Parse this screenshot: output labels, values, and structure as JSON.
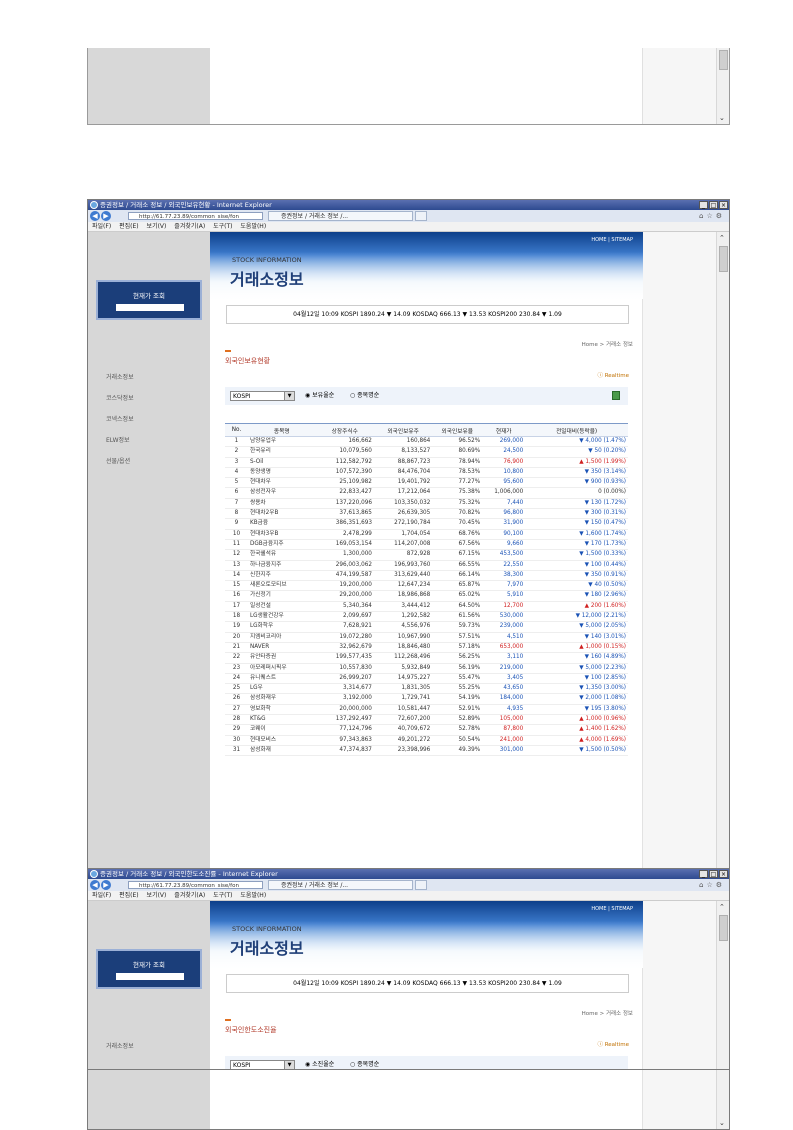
{
  "window": {
    "title1": "증권정보 / 거래소 정보 / 외국인보유현황 - Internet Explorer",
    "title2": "증권정보 / 거래소 정보 / 외국인한도소진률 - Internet Explorer",
    "url": "http://61.77.23.89/common_sise/fon",
    "tab_label": "증권정보 / 거래소 정보 /...",
    "menu": [
      "파일(F)",
      "편집(E)",
      "보기(V)",
      "즐겨찾기(A)",
      "도구(T)",
      "도움말(H)"
    ]
  },
  "banner": {
    "subtitle": "STOCK INFORMATION",
    "title": "거래소정보",
    "links": "HOME  |  SITEMAP"
  },
  "sidebar": {
    "current_price_label": "현재가 조회",
    "items": [
      "거래소정보",
      "코스닥정보",
      "코넥스정보",
      "ELW정보",
      "선물/옵션"
    ]
  },
  "ticker": "04월12일  10:09  KOSPI  1890.24  ▼ 14.09  KOSDAQ  666.13  ▼ 13.53  KOSPI200  230.84  ▼ 1.09",
  "breadcrumb": "Home > 거래소 정보",
  "realtime": "Realtime",
  "page1": {
    "section_title": "외국인보유현황",
    "market": "KOSPI",
    "radio1": "보유율순",
    "radio2": "종목명순"
  },
  "page2": {
    "section_title": "외국인한도소진율",
    "market": "KOSPI",
    "radio1": "소진율순",
    "radio2": "종목명순"
  },
  "table": {
    "headers": [
      "No.",
      "종목명",
      "상장주식수",
      "외국인보유주",
      "외국인보유율",
      "현재가",
      "전일대비(등락율)"
    ],
    "rows": [
      [
        "1",
        "남양유업우",
        "166,662",
        "160,864",
        "96.52%",
        "269,000",
        "▼ 4,000 (1.47%)"
      ],
      [
        "2",
        "한국유리",
        "10,079,560",
        "8,133,527",
        "80.69%",
        "24,500",
        "▼ 50 (0.20%)"
      ],
      [
        "3",
        "S-Oil",
        "112,582,792",
        "88,867,723",
        "78.94%",
        "76,900",
        "▲ 1,500 (1.99%)"
      ],
      [
        "4",
        "동양생명",
        "107,572,390",
        "84,476,704",
        "78.53%",
        "10,800",
        "▼ 350 (3.14%)"
      ],
      [
        "5",
        "현대차우",
        "25,109,982",
        "19,401,792",
        "77.27%",
        "95,600",
        "▼ 900 (0.93%)"
      ],
      [
        "6",
        "삼성전자우",
        "22,833,427",
        "17,212,064",
        "75.38%",
        "1,006,000",
        "0 (0.00%)"
      ],
      [
        "7",
        "쌍용차",
        "137,220,096",
        "103,350,032",
        "75.32%",
        "7,440",
        "▼ 130 (1.72%)"
      ],
      [
        "8",
        "현대차2우B",
        "37,613,865",
        "26,639,305",
        "70.82%",
        "96,800",
        "▼ 300 (0.31%)"
      ],
      [
        "9",
        "KB금융",
        "386,351,693",
        "272,190,784",
        "70.45%",
        "31,900",
        "▼ 150 (0.47%)"
      ],
      [
        "10",
        "현대차3우B",
        "2,478,299",
        "1,704,054",
        "68.76%",
        "90,100",
        "▼ 1,600 (1.74%)"
      ],
      [
        "11",
        "DGB금융지주",
        "169,053,154",
        "114,207,008",
        "67.56%",
        "9,660",
        "▼ 170 (1.73%)"
      ],
      [
        "12",
        "한국쉘석유",
        "1,300,000",
        "872,928",
        "67.15%",
        "453,500",
        "▼ 1,500 (0.33%)"
      ],
      [
        "13",
        "하나금융지주",
        "296,003,062",
        "196,993,760",
        "66.55%",
        "22,550",
        "▼ 100 (0.44%)"
      ],
      [
        "14",
        "신한지주",
        "474,199,587",
        "313,629,440",
        "66.14%",
        "38,300",
        "▼ 350 (0.91%)"
      ],
      [
        "15",
        "새론오토모티브",
        "19,200,000",
        "12,647,234",
        "65.87%",
        "7,970",
        "▼ 40 (0.50%)"
      ],
      [
        "16",
        "가신정기",
        "29,200,000",
        "18,986,868",
        "65.02%",
        "5,910",
        "▼ 180 (2.96%)"
      ],
      [
        "17",
        "일성건설",
        "5,340,364",
        "3,444,412",
        "64.50%",
        "12,700",
        "▲ 200 (1.60%)"
      ],
      [
        "18",
        "LG생활건강우",
        "2,099,697",
        "1,292,582",
        "61.56%",
        "530,000",
        "▼ 12,000 (2.21%)"
      ],
      [
        "19",
        "LG화학우",
        "7,628,921",
        "4,556,976",
        "59.73%",
        "239,000",
        "▼ 5,000 (2.05%)"
      ],
      [
        "20",
        "지엠비코리아",
        "19,072,280",
        "10,967,990",
        "57.51%",
        "4,510",
        "▼ 140 (3.01%)"
      ],
      [
        "21",
        "NAVER",
        "32,962,679",
        "18,846,480",
        "57.18%",
        "653,000",
        "▲ 1,000 (0.15%)"
      ],
      [
        "22",
        "유안타증권",
        "199,577,435",
        "112,268,496",
        "56.25%",
        "3,110",
        "▼ 160 (4.89%)"
      ],
      [
        "23",
        "아모레퍼시픽우",
        "10,557,830",
        "5,932,849",
        "56.19%",
        "219,000",
        "▼ 5,000 (2.23%)"
      ],
      [
        "24",
        "유니퀘스트",
        "26,999,207",
        "14,975,227",
        "55.47%",
        "3,405",
        "▼ 100 (2.85%)"
      ],
      [
        "25",
        "LG우",
        "3,314,677",
        "1,831,305",
        "55.25%",
        "43,650",
        "▼ 1,350 (3.00%)"
      ],
      [
        "26",
        "삼성화재우",
        "3,192,000",
        "1,729,741",
        "54.19%",
        "184,000",
        "▼ 2,000 (1.08%)"
      ],
      [
        "27",
        "영보화학",
        "20,000,000",
        "10,581,447",
        "52.91%",
        "4,935",
        "▼ 195 (3.80%)"
      ],
      [
        "28",
        "KT&G",
        "137,292,497",
        "72,607,200",
        "52.89%",
        "105,000",
        "▲ 1,000 (0.96%)"
      ],
      [
        "29",
        "코웨이",
        "77,124,796",
        "40,709,672",
        "52.78%",
        "87,800",
        "▲ 1,400 (1.62%)"
      ],
      [
        "30",
        "현대모비스",
        "97,343,863",
        "49,201,272",
        "50.54%",
        "241,000",
        "▲ 4,000 (1.69%)"
      ],
      [
        "31",
        "삼성화재",
        "47,374,837",
        "23,398,996",
        "49.39%",
        "301,000",
        "▼ 1,500 (0.50%)"
      ]
    ]
  },
  "colors": {
    "down": "#1a52b5",
    "up": "#d02020",
    "section_title": "#b23a2a",
    "sidebar": "#d7d7d7",
    "nav_box": "#1b3e7a"
  }
}
